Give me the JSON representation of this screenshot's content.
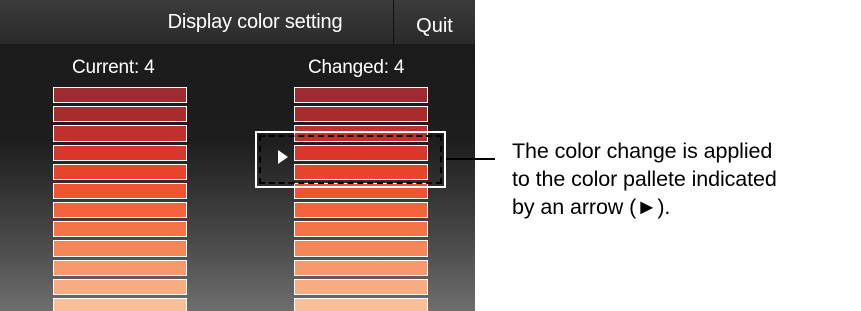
{
  "header": {
    "title": "Display color setting",
    "quit_label": "Quit"
  },
  "current": {
    "label": "Current: 4",
    "swatches": [
      "#9e2b2f",
      "#a82c2e",
      "#c0302d",
      "#d9372c",
      "#e8442c",
      "#ee5332",
      "#f2633b",
      "#f47447",
      "#f58658",
      "#f7996c",
      "#f8ac82",
      "#f9bf99"
    ]
  },
  "changed": {
    "label": "Changed: 4",
    "selected_index": 2,
    "arrow_glyph": "right-triangle-arrow-icon",
    "swatches": [
      "#9e2b2f",
      "#a82c2e",
      "#c0302d",
      "#d9372c",
      "#e8442c",
      "#ee5332",
      "#f2633b",
      "#f47447",
      "#f58658",
      "#f7996c",
      "#f8ac82",
      "#f9bf99"
    ]
  },
  "callout": {
    "lines": [
      "The color change is applied",
      "to the color pallete indicated",
      "by an arrow (►)."
    ]
  }
}
